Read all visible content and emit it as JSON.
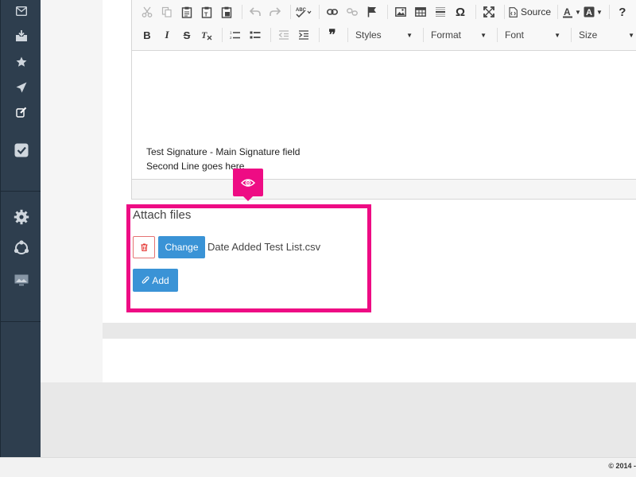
{
  "sidebar": {
    "items": [
      {
        "icon": "envelope-icon"
      },
      {
        "icon": "inbox-download-icon"
      },
      {
        "icon": "star-icon"
      },
      {
        "icon": "paper-plane-icon"
      },
      {
        "icon": "edit-icon"
      },
      {
        "icon": "check-square-icon"
      },
      {
        "icon": "gear-icon"
      },
      {
        "icon": "nodes-icon"
      },
      {
        "icon": "image-monitor-icon"
      }
    ]
  },
  "editor": {
    "toolbar": {
      "source_label": "Source",
      "styles_label": "Styles",
      "format_label": "Format",
      "font_label": "Font",
      "size_label": "Size",
      "bold_label": "B",
      "italic_label": "I",
      "strike_label": "S",
      "help_label": "?",
      "quote_label": "❞",
      "omega_label": "Ω"
    },
    "signature_line1": "Test Signature - Main Signature field",
    "signature_line2": "Second Line goes here"
  },
  "attach": {
    "title": "Attach files",
    "change_label": "Change",
    "file_name": "Date Added Test List.csv",
    "add_label": "Add"
  },
  "footer": {
    "copyright": "© 2014 -"
  },
  "colors": {
    "sidebar": "#2e3e4e",
    "accent_blue": "#3a93d6",
    "highlight": "#ee0c84",
    "delete_red": "#e57373"
  }
}
